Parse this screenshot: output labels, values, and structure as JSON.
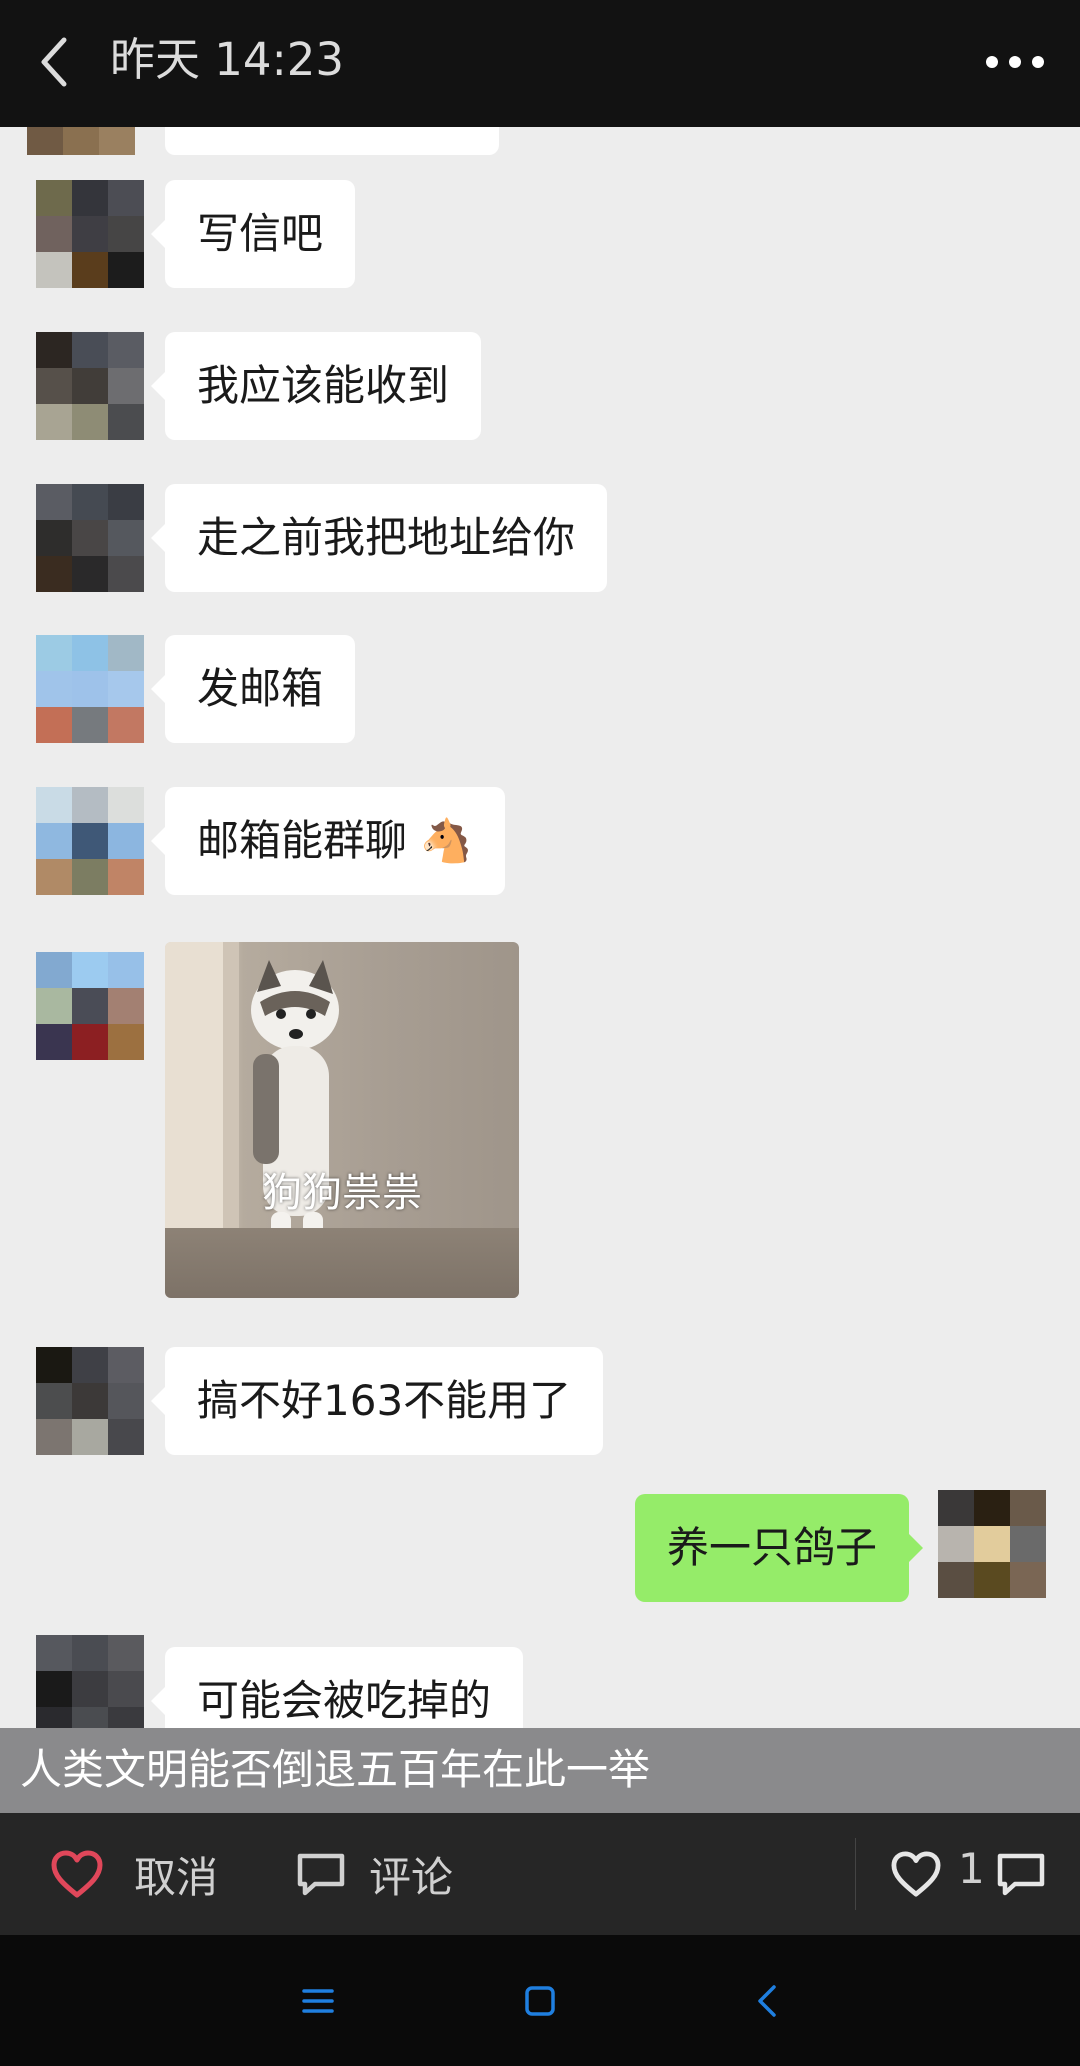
{
  "header": {
    "title": "昨天 14:23"
  },
  "messages": [
    {
      "side": "left",
      "text": "写信吧"
    },
    {
      "side": "left",
      "text": "我应该能收到"
    },
    {
      "side": "left",
      "text": "走之前我把地址给你"
    },
    {
      "side": "left",
      "text": "发邮箱"
    },
    {
      "side": "left",
      "text": "邮箱能群聊 🐴"
    },
    {
      "side": "left",
      "sticker_caption": "狗狗祟祟"
    },
    {
      "side": "left",
      "text": "搞不好163不能用了"
    },
    {
      "side": "right",
      "text": "养一只鸽子"
    },
    {
      "side": "left",
      "text": "可能会被吃掉的"
    }
  ],
  "caption": "人类文明能否倒退五百年在此一举",
  "actions": {
    "cancel_label": "取消",
    "comment_label": "评论",
    "like_count": "1"
  },
  "colors": {
    "my_bubble": "#95ec69",
    "like_heart": "#e0475a",
    "nav_accent": "#1f7fe0"
  }
}
